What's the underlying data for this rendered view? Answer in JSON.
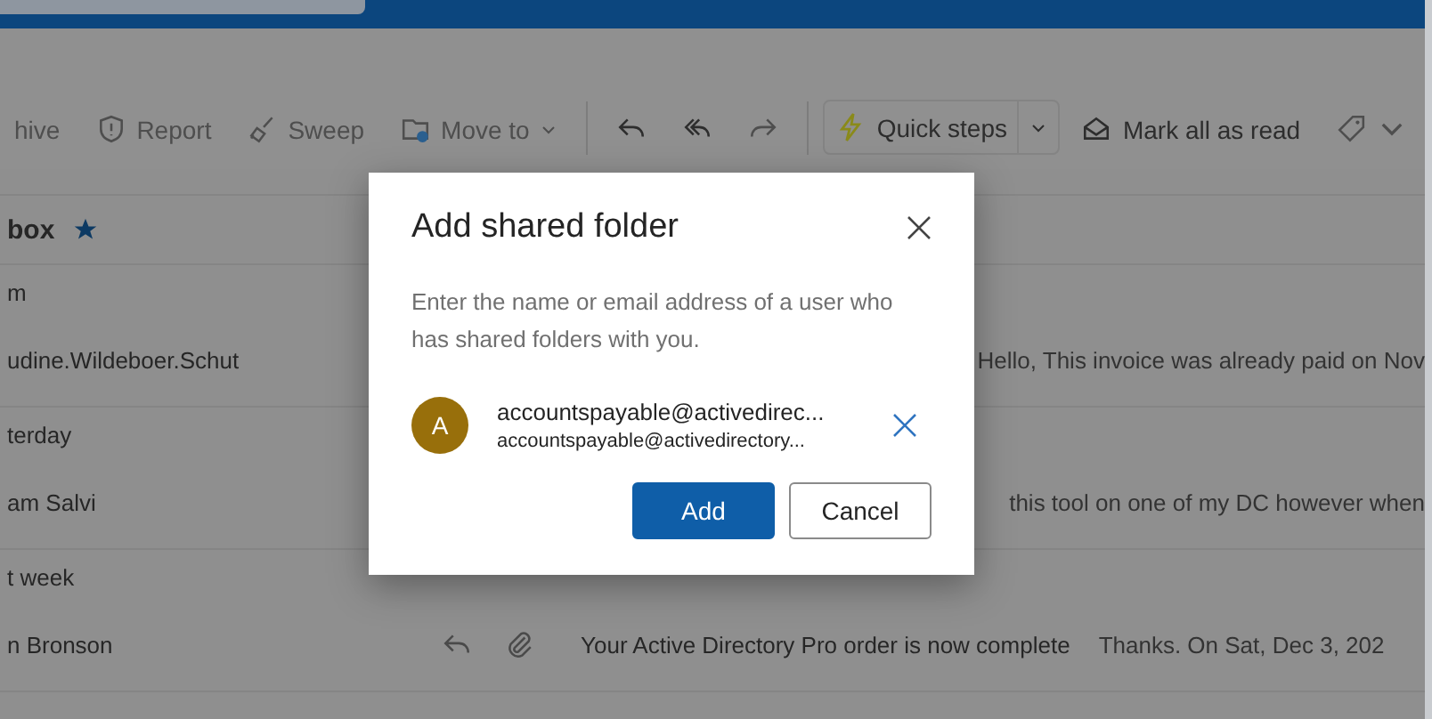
{
  "toolbar": [
    {
      "kind": "text",
      "label": "hive",
      "disabled": true
    },
    {
      "kind": "report",
      "label": "Report",
      "disabled": true
    },
    {
      "kind": "sweep",
      "label": "Sweep",
      "disabled": true
    },
    {
      "kind": "move",
      "label": "Move to",
      "disabled": true
    },
    {
      "kind": "reply",
      "disabled": false
    },
    {
      "kind": "reply-all",
      "disabled": false
    },
    {
      "kind": "forward",
      "disabled": true
    },
    {
      "kind": "quick",
      "label": "Quick steps",
      "disabled": false
    },
    {
      "kind": "mark",
      "label": "Mark all as read",
      "disabled": false
    },
    {
      "kind": "tag",
      "disabled": true
    }
  ],
  "folder": {
    "name": "box",
    "favorite": true
  },
  "groups": [
    {
      "label": "m",
      "messages": [
        {
          "sender": "udine.Wildeboer.Schut",
          "preview": "Hello, This invoice was already paid on Nov"
        }
      ]
    },
    {
      "label": "terday",
      "messages": [
        {
          "sender": "am Salvi",
          "preview": "this tool on one of my DC however when"
        }
      ]
    },
    {
      "label": "t week",
      "messages": [
        {
          "sender": "n Bronson",
          "subject": "Your Active Directory Pro order is now complete",
          "preview": "Thanks. On Sat, Dec 3, 202",
          "attachment": true,
          "replied": true
        }
      ]
    }
  ],
  "dialog": {
    "title": "Add shared folder",
    "description": "Enter the name or email address of a user who has shared folders with you.",
    "people": [
      {
        "initial": "A",
        "name": "accountspayable@activedirec...",
        "email": "accountspayable@activedirectory..."
      }
    ],
    "buttons": [
      {
        "label": "Add",
        "kind": "primary"
      },
      {
        "label": "Cancel",
        "kind": "secondary"
      }
    ]
  }
}
